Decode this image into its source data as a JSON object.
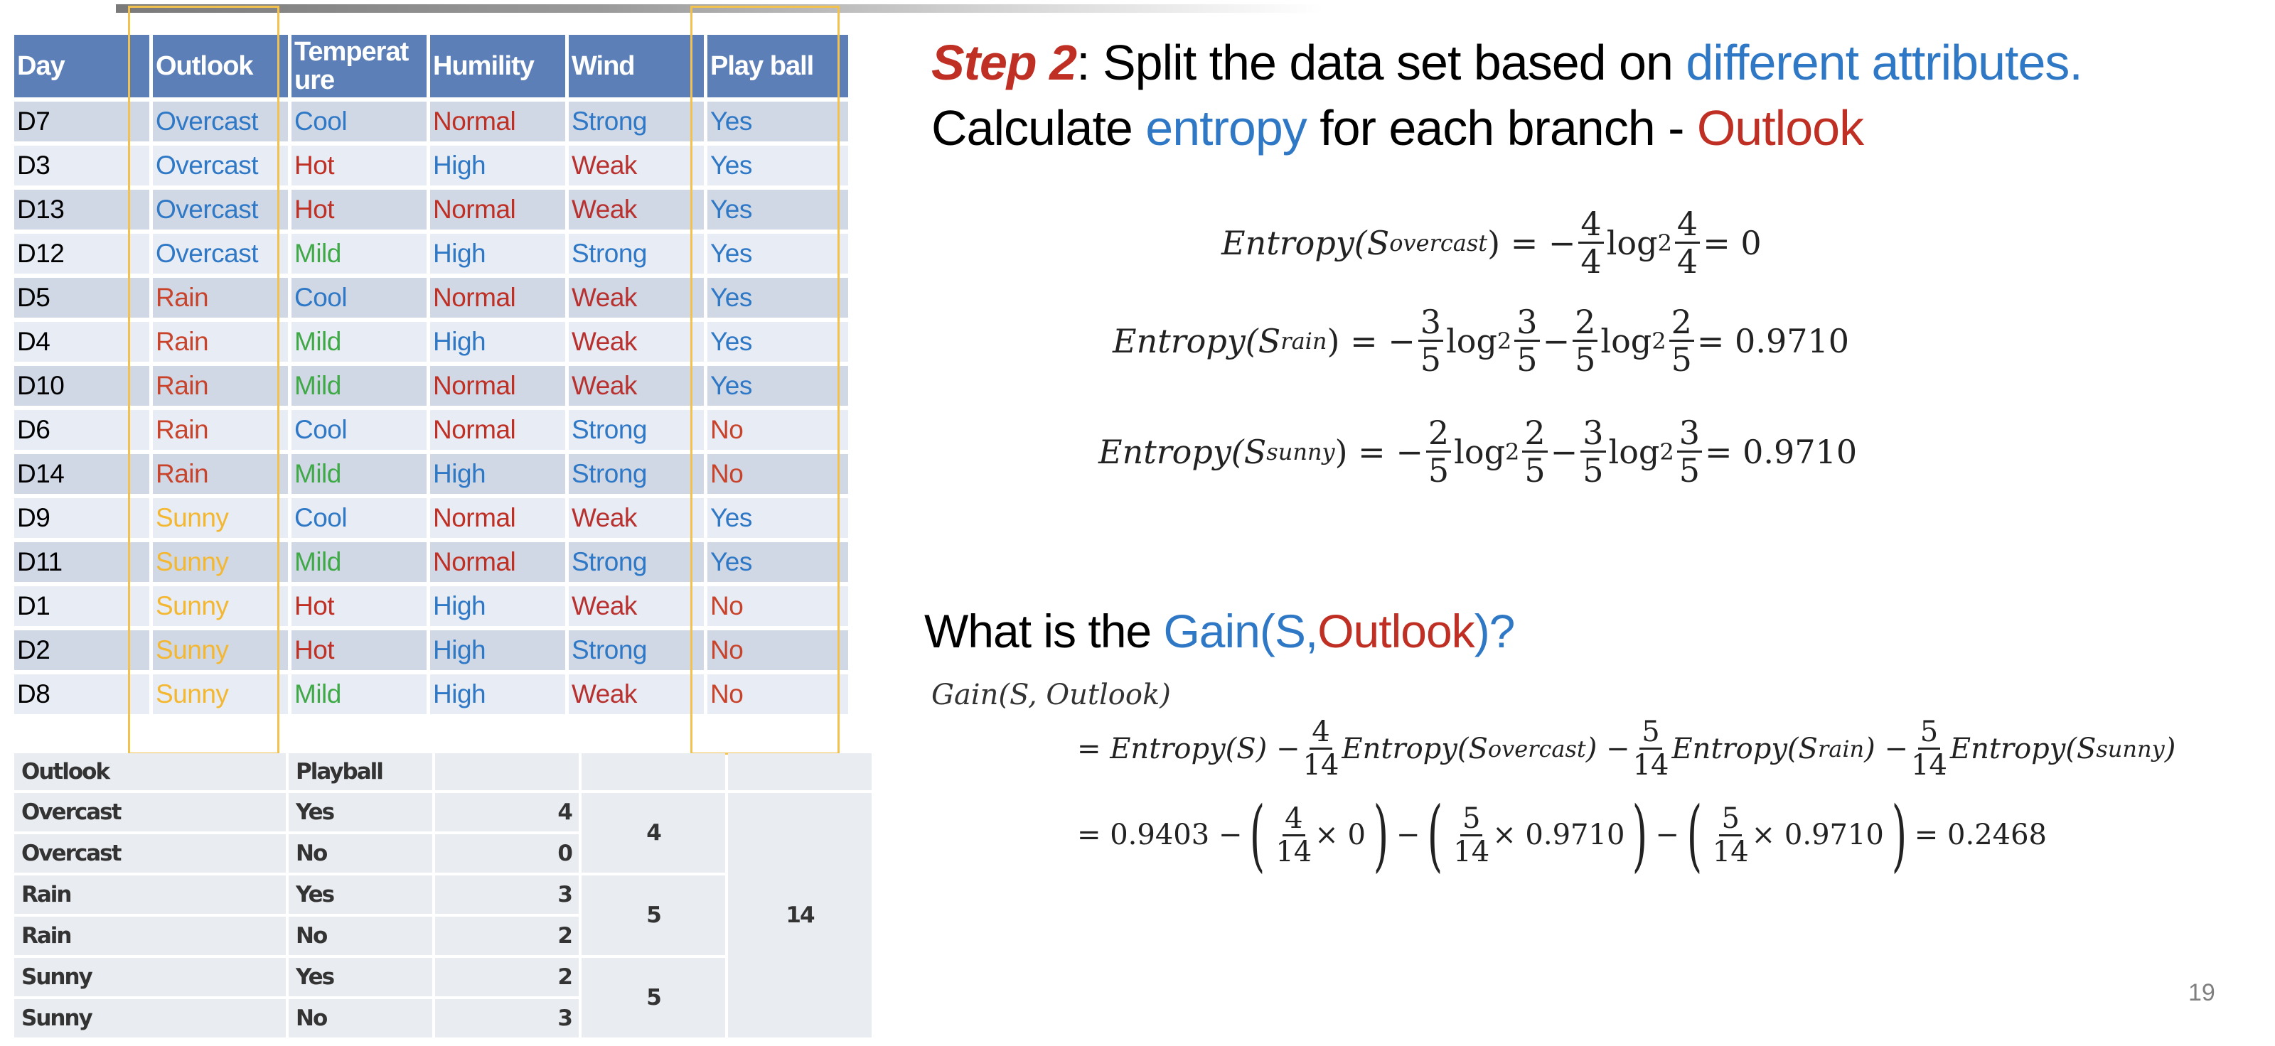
{
  "slide": {
    "page_number": "19",
    "colors": {
      "header_bg": "#5b7fb6",
      "row_odd": "#d0d8e6",
      "row_even": "#e8ecf4",
      "highlight_box": "#f2c14e",
      "red": "#bf2f24",
      "blue": "#2f78c6",
      "green": "#3fa847",
      "yellow": "#f4b731"
    }
  },
  "data_table": {
    "headers": [
      "Day",
      "Outlook",
      "Temperature",
      "Humility",
      "Wind",
      "Play ball"
    ],
    "rows": [
      [
        "D7",
        "Overcast",
        "Cool",
        "Normal",
        "Strong",
        "Yes"
      ],
      [
        "D3",
        "Overcast",
        "Hot",
        "High",
        "Weak",
        "Yes"
      ],
      [
        "D13",
        "Overcast",
        "Hot",
        "Normal",
        "Weak",
        "Yes"
      ],
      [
        "D12",
        "Overcast",
        "Mild",
        "High",
        "Strong",
        "Yes"
      ],
      [
        "D5",
        "Rain",
        "Cool",
        "Normal",
        "Weak",
        "Yes"
      ],
      [
        "D4",
        "Rain",
        "Mild",
        "High",
        "Weak",
        "Yes"
      ],
      [
        "D10",
        "Rain",
        "Mild",
        "Normal",
        "Weak",
        "Yes"
      ],
      [
        "D6",
        "Rain",
        "Cool",
        "Normal",
        "Strong",
        "No"
      ],
      [
        "D14",
        "Rain",
        "Mild",
        "High",
        "Strong",
        "No"
      ],
      [
        "D9",
        "Sunny",
        "Cool",
        "Normal",
        "Weak",
        "Yes"
      ],
      [
        "D11",
        "Sunny",
        "Mild",
        "Normal",
        "Strong",
        "Yes"
      ],
      [
        "D1",
        "Sunny",
        "Hot",
        "High",
        "Weak",
        "No"
      ],
      [
        "D2",
        "Sunny",
        "Hot",
        "High",
        "Strong",
        "No"
      ],
      [
        "D8",
        "Sunny",
        "Mild",
        "High",
        "Weak",
        "No"
      ]
    ],
    "value_colors": {
      "Overcast": "#2f78c6",
      "Rain": "#c8432a",
      "Sunny": "#f4b731",
      "Cool": "#2f78c6",
      "Hot": "#bf2f24",
      "Mild": "#3fa847",
      "Normal": "#bf2f24",
      "High": "#2f78c6",
      "Strong": "#2f78c6",
      "Weak": "#b8312f",
      "Yes": "#2f78c6",
      "No": "#c8432a"
    }
  },
  "summary_table": {
    "headers": [
      "Outlook",
      "Playball",
      "",
      "",
      ""
    ],
    "rows": [
      {
        "outlook": "Overcast",
        "playball": "Yes",
        "count": "4"
      },
      {
        "outlook": "Overcast",
        "playball": "No",
        "count": "0"
      },
      {
        "outlook": "Rain",
        "playball": "Yes",
        "count": "3"
      },
      {
        "outlook": "Rain",
        "playball": "No",
        "count": "2"
      },
      {
        "outlook": "Sunny",
        "playball": "Yes",
        "count": "2"
      },
      {
        "outlook": "Sunny",
        "playball": "No",
        "count": "3"
      }
    ],
    "group_totals": [
      "4",
      "5",
      "5"
    ],
    "grand_total": "14"
  },
  "heading": {
    "step_label": "Step 2",
    "line1_rest": ": Split the data set based on ",
    "line1_highlight": "different attributes.",
    "line2_start": "Calculate ",
    "line2_highlight": "entropy",
    "line2_mid": " for each branch - ",
    "line2_attr": "Outlook"
  },
  "entropy_formulas": [
    {
      "label": "Entropy(",
      "subscript": "overcast",
      "terms": [
        [
          "4",
          "4"
        ],
        [
          "4",
          "4"
        ]
      ],
      "result": "0"
    },
    {
      "label": "Entropy(",
      "subscript": "rain",
      "terms": [
        [
          "3",
          "5"
        ],
        [
          "3",
          "5"
        ],
        [
          "2",
          "5"
        ],
        [
          "2",
          "5"
        ]
      ],
      "result": "0.9710"
    },
    {
      "label": "Entropy(",
      "subscript": "sunny",
      "terms": [
        [
          "2",
          "5"
        ],
        [
          "2",
          "5"
        ],
        [
          "3",
          "5"
        ],
        [
          "3",
          "5"
        ]
      ],
      "result": "0.9710"
    }
  ],
  "question": {
    "prefix": "What is the ",
    "gain_open": "Gain(S,",
    "attr": "Outlook",
    "gain_close": ")?"
  },
  "gain_formula": {
    "label": "Gain(S, Outlook)",
    "line1": {
      "entropy_s": "= Entropy(S) − ",
      "w1": [
        "4",
        "14"
      ],
      "t1": "Entropy(S",
      "s1": "overcast",
      "m1": ") − ",
      "w2": [
        "5",
        "14"
      ],
      "t2": "Entropy(S",
      "s2": "rain",
      "m2": ") − ",
      "w3": [
        "5",
        "14"
      ],
      "t3": "Entropy(S",
      "s3": "sunny",
      "m3": ")"
    },
    "line2": {
      "start": "= 0.9403 − ",
      "w1": [
        "4",
        "14"
      ],
      "v1": "× 0",
      "w2": [
        "5",
        "14"
      ],
      "v2": "× 0.9710",
      "w3": [
        "5",
        "14"
      ],
      "v3": "× 0.9710",
      "result": "= 0.2468"
    }
  }
}
